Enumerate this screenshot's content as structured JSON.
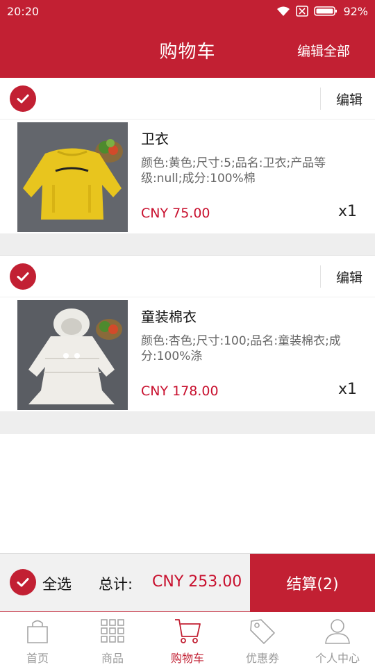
{
  "status_bar": {
    "time": "20:20",
    "battery": "92%",
    "icons": [
      "wifi-icon",
      "sim-off-icon",
      "battery-icon"
    ]
  },
  "header": {
    "title": "购物车",
    "edit_all": "编辑全部"
  },
  "cart": {
    "items": [
      {
        "name": "卫衣",
        "description": "颜色:黄色;尺寸:5;品名:卫衣;产品等级:null;成分:100%棉",
        "price": "CNY 75.00",
        "quantity": "x1",
        "edit_label": "编辑",
        "checked": true,
        "image": "yellow-sweatshirt"
      },
      {
        "name": "童装棉衣",
        "description": "颜色:杏色;尺寸:100;品名:童装棉衣;成分:100%涤",
        "price": "CNY 178.00",
        "quantity": "x1",
        "edit_label": "编辑",
        "checked": true,
        "image": "white-padded-jacket"
      }
    ]
  },
  "checkout": {
    "select_all": "全选",
    "total_label": "总计:",
    "total_value": "CNY 253.00",
    "button": "结算(2)"
  },
  "tabs": [
    {
      "label": "首页",
      "icon": "bag-icon",
      "active": false
    },
    {
      "label": "商品",
      "icon": "grid-icon",
      "active": false
    },
    {
      "label": "购物车",
      "icon": "cart-icon",
      "active": true
    },
    {
      "label": "优惠券",
      "icon": "tag-icon",
      "active": false
    },
    {
      "label": "个人中心",
      "icon": "user-icon",
      "active": false
    }
  ],
  "colors": {
    "brand": "#c22033",
    "price": "#c8102e",
    "tab_inactive": "#9a9a9a"
  }
}
